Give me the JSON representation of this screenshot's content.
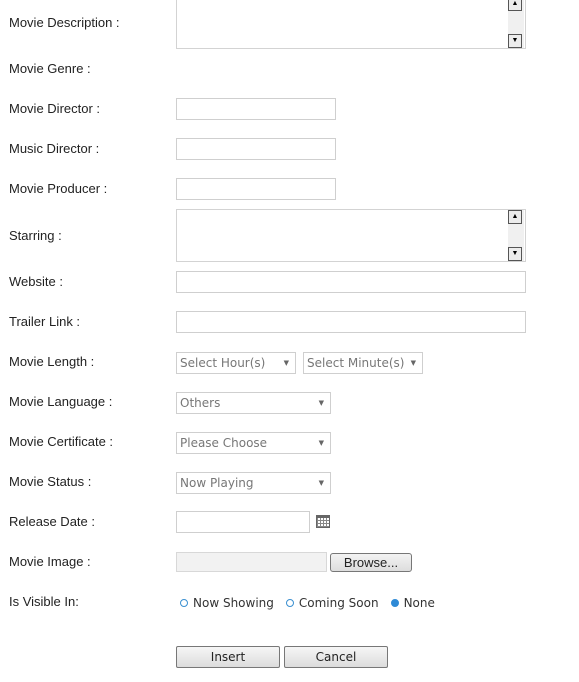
{
  "labels": {
    "description": "Movie Description :",
    "genre": "Movie Genre :",
    "director": "Movie Director :",
    "music_director": "Music Director :",
    "producer": "Movie Producer :",
    "starring": "Starring :",
    "website": "Website :",
    "trailer": "Trailer Link :",
    "length": "Movie Length :",
    "language": "Movie Language :",
    "certificate": "Movie Certificate :",
    "status": "Movie Status :",
    "release_date": "Release Date :",
    "image": "Movie Image :",
    "visible_in": "Is Visible In:"
  },
  "fields": {
    "description": "",
    "director": "",
    "music_director": "",
    "producer": "",
    "starring": "",
    "website": "",
    "trailer": "",
    "release_date": ""
  },
  "selects": {
    "hours": "Select Hour(s)",
    "minutes": "Select Minute(s)",
    "language": "Others",
    "certificate": "Please Choose",
    "status": "Now Playing"
  },
  "browse_label": "Browse...",
  "visibility": {
    "options": [
      "Now Showing",
      "Coming Soon",
      "None"
    ],
    "selected": "None"
  },
  "buttons": {
    "insert": "Insert",
    "cancel": "Cancel"
  },
  "icons": {
    "scroll_up": "scroll-up-arrow",
    "scroll_down": "scroll-down-arrow",
    "dropdown": "dropdown-arrow",
    "calendar": "calendar-icon"
  },
  "colors": {
    "radio_accent": "#2e8ad6"
  }
}
